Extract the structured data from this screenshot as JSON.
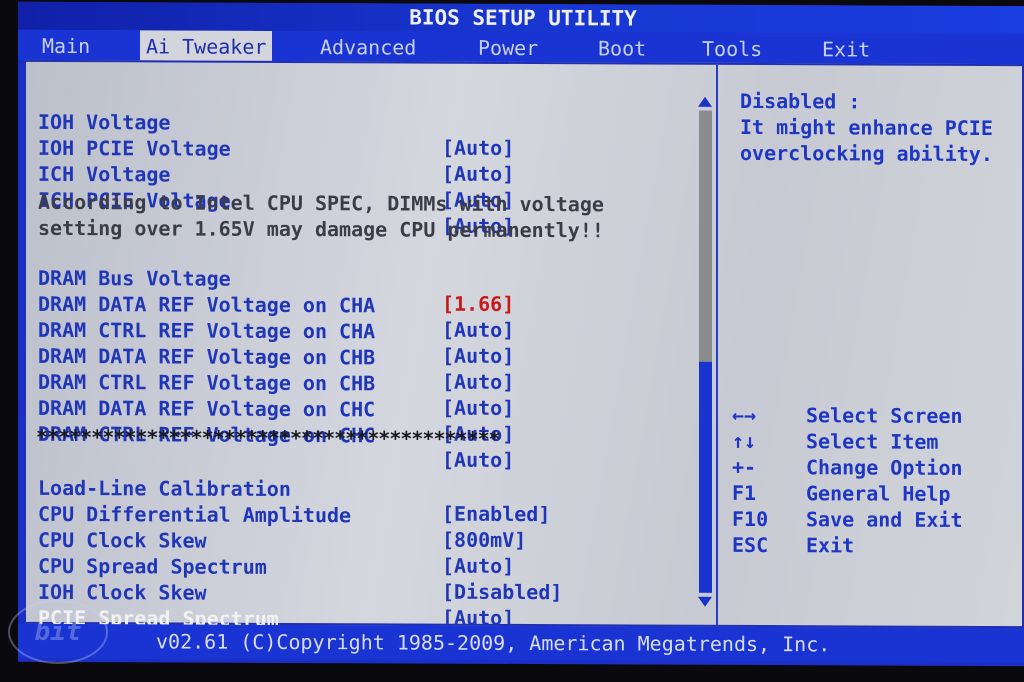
{
  "title": "BIOS SETUP UTILITY",
  "tabs": [
    {
      "label": "Main",
      "active": false
    },
    {
      "label": "Ai Tweaker",
      "active": true
    },
    {
      "label": "Advanced",
      "active": false
    },
    {
      "label": "Power",
      "active": false
    },
    {
      "label": "Boot",
      "active": false
    },
    {
      "label": "Tools",
      "active": false
    },
    {
      "label": "Exit",
      "active": false
    }
  ],
  "settings_top": [
    {
      "label": "IOH Voltage",
      "value": "[Auto]"
    },
    {
      "label": "IOH PCIE Voltage",
      "value": "[Auto]"
    },
    {
      "label": "ICH Voltage",
      "value": "[Auto]"
    },
    {
      "label": "ICH PCIE Voltage",
      "value": "[Auto]"
    }
  ],
  "warning": {
    "line1": "According to Intel CPU SPEC, DIMMs with voltage",
    "line2": "setting over 1.65V may damage CPU permanently!!"
  },
  "settings_dram": [
    {
      "label": "DRAM Bus Voltage",
      "value": "[1.66]",
      "highlight": "red"
    },
    {
      "label": "DRAM DATA REF Voltage on CHA",
      "value": "[Auto]"
    },
    {
      "label": "DRAM CTRL REF Voltage on CHA",
      "value": "[Auto]"
    },
    {
      "label": "DRAM DATA REF Voltage on CHB",
      "value": "[Auto]"
    },
    {
      "label": "DRAM CTRL REF Voltage on CHB",
      "value": "[Auto]"
    },
    {
      "label": "DRAM DATA REF Voltage on CHC",
      "value": "[Auto]"
    },
    {
      "label": "DRAM CTRL REF Voltage on CHC",
      "value": "[Auto]"
    }
  ],
  "separator": "******************************************",
  "settings_bottom": [
    {
      "label": "Load-Line Calibration",
      "value": "[Enabled]"
    },
    {
      "label": "CPU Differential Amplitude",
      "value": "[800mV]"
    },
    {
      "label": "CPU Clock Skew",
      "value": "[Auto]"
    },
    {
      "label": "CPU Spread Spectrum",
      "value": "[Disabled]"
    },
    {
      "label": "IOH Clock Skew",
      "value": "[Auto]"
    },
    {
      "label": "PCIE Spread Spectrum",
      "value": "[Disabled]",
      "selected": true
    }
  ],
  "scrollbar": {
    "position_fraction": 0.52
  },
  "help": {
    "line1": "Disabled :",
    "line2": "It might enhance PCIE",
    "line3": "overclocking ability."
  },
  "keys": [
    {
      "key": "←→",
      "desc": "Select Screen"
    },
    {
      "key": "↑↓",
      "desc": "Select Item"
    },
    {
      "key": "+-",
      "desc": "Change Option"
    },
    {
      "key": "F1",
      "desc": "General Help"
    },
    {
      "key": "F10",
      "desc": "Save and Exit"
    },
    {
      "key": "ESC",
      "desc": "Exit"
    }
  ],
  "footer": "v02.61 (C)Copyright 1985-2009, American Megatrends, Inc.",
  "watermark": "bit",
  "colors": {
    "frame_blue": "#1a34d4",
    "panel_gray": "#c9ccd6",
    "text_blue": "#2036b8",
    "value_red": "#c81818",
    "selected_white": "#f2f2f4"
  }
}
